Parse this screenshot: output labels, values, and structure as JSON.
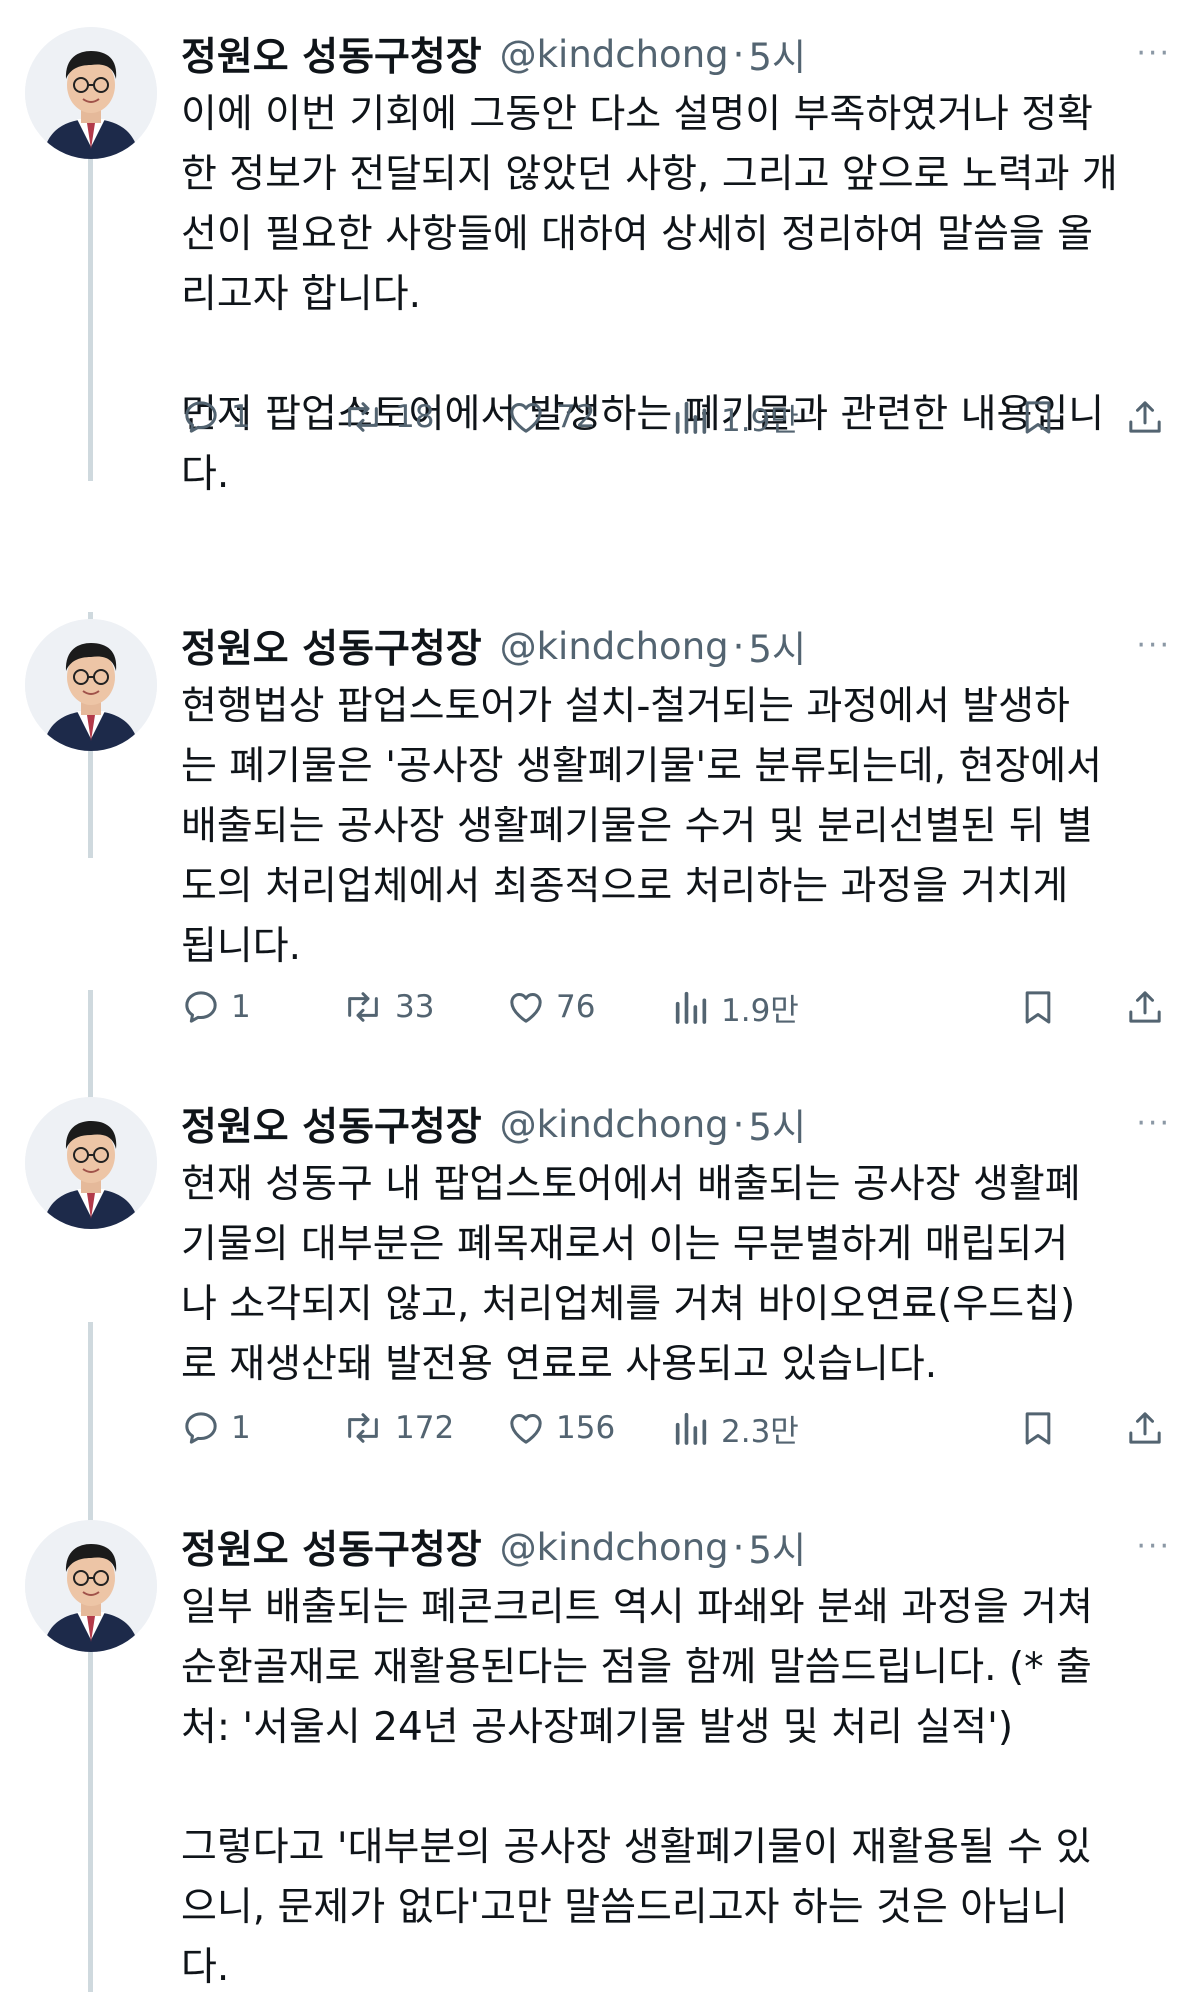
{
  "tweets": [
    {
      "author": {
        "name": "정원오 성동구청장",
        "handle": "@kindchong"
      },
      "separator": "·",
      "time": "5시",
      "more": "···",
      "body": "이에 이번 기회에 그동안 다소 설명이 부족하였거나 정확\n한 정보가 전달되지 않았던 사항, 그리고 앞으로 노력과 개\n선이 필요한 사항들에 대하여 상세히 정리하여 말씀을 올\n리고자 합니다.\n\n먼저 팝업스토어에서 발생하는 폐기물과 관련한 내용입니\n다.",
      "stats": {
        "replies": "1",
        "reposts": "18",
        "likes": "72",
        "views": "1.9만"
      }
    },
    {
      "author": {
        "name": "정원오 성동구청장",
        "handle": "@kindchong"
      },
      "separator": "·",
      "time": "5시",
      "more": "···",
      "body": "현행법상 팝업스토어가 설치-철거되는 과정에서 발생하\n는 폐기물은 '공사장 생활폐기물'로 분류되는데, 현장에서\n배출되는 공사장 생활폐기물은 수거 및 분리선별된 뒤 별\n도의 처리업체에서 최종적으로 처리하는 과정을 거치게\n됩니다.",
      "stats": {
        "replies": "1",
        "reposts": "33",
        "likes": "76",
        "views": "1.9만"
      }
    },
    {
      "author": {
        "name": "정원오 성동구청장",
        "handle": "@kindchong"
      },
      "separator": "·",
      "time": "5시",
      "more": "···",
      "body": "현재 성동구 내 팝업스토어에서 배출되는 공사장 생활폐\n기물의 대부분은 폐목재로서 이는 무분별하게 매립되거\n나 소각되지 않고, 처리업체를 거쳐 바이오연료(우드칩)\n로 재생산돼 발전용 연료로 사용되고 있습니다.",
      "stats": {
        "replies": "1",
        "reposts": "172",
        "likes": "156",
        "views": "2.3만"
      }
    },
    {
      "author": {
        "name": "정원오 성동구청장",
        "handle": "@kindchong"
      },
      "separator": "·",
      "time": "5시",
      "more": "···",
      "body": "일부 배출되는 폐콘크리트 역시 파쇄와 분쇄 과정을 거쳐\n순환골재로 재활용된다는 점을 함께 말씀드립니다. (* 출\n처: '서울시 24년 공사장폐기물 발생 및 처리 실적')\n\n그렇다고 '대부분의 공사장 생활폐기물이 재활용될 수 있\n으니, 문제가 없다'고만 말씀드리고자 하는 것은 아닙니\n다."
    }
  ]
}
